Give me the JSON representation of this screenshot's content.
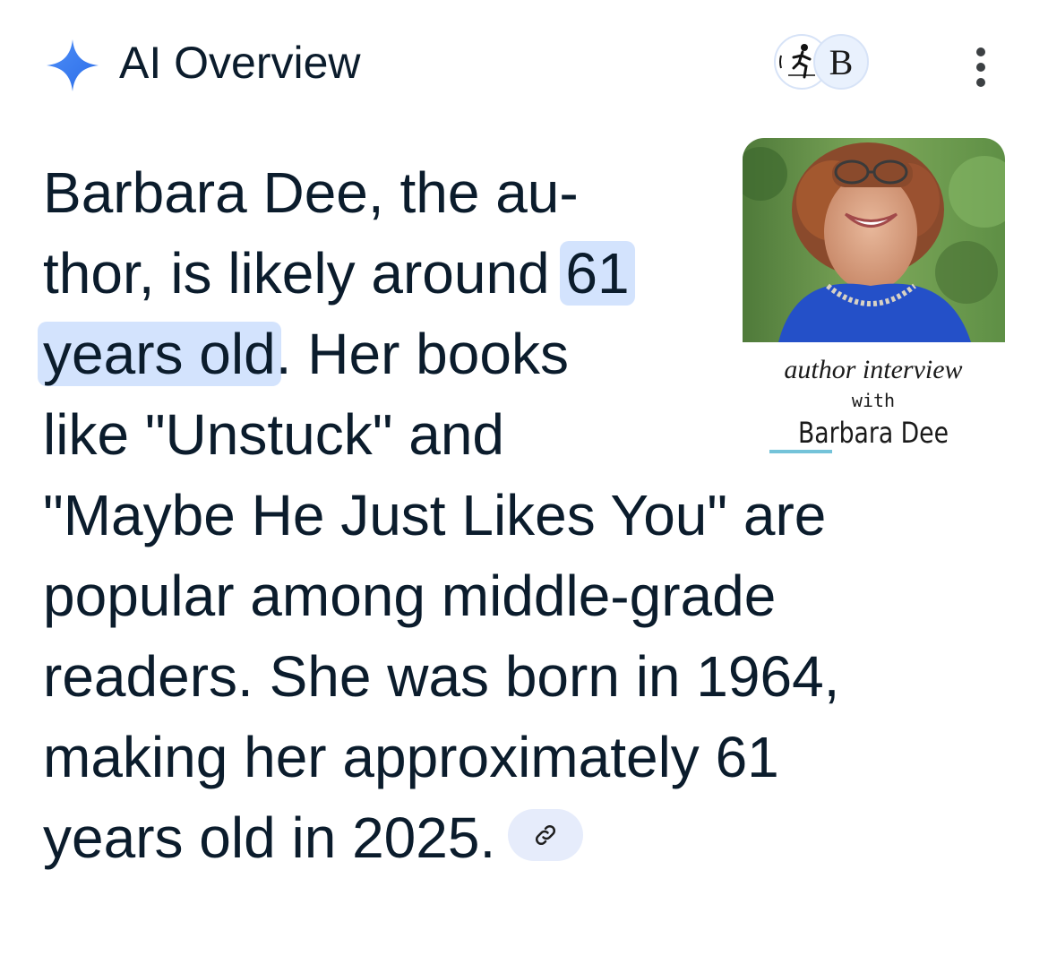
{
  "header": {
    "title": "AI Overview",
    "source_avatar_letter": "B",
    "sparkle_icon": "gemini-sparkle-icon",
    "more_icon": "more-vert-icon"
  },
  "thumbnail": {
    "caption_line1": "author interview",
    "caption_line2": "with",
    "caption_line3": "Barbara Dee"
  },
  "answer": {
    "lines": [
      {
        "before": "Barbara Dee, the au-",
        "highlight": "",
        "after": ""
      },
      {
        "before": "thor, is likely around ",
        "highlight": "61",
        "after": ""
      },
      {
        "before": "",
        "highlight": "years old",
        "after": ". Her books"
      },
      {
        "before": "like \"Unstuck\" and",
        "highlight": "",
        "after": ""
      },
      {
        "before": "\"Maybe He Just Likes You\" are",
        "highlight": "",
        "after": ""
      },
      {
        "before": "popular among middle-grade",
        "highlight": "",
        "after": ""
      },
      {
        "before": "readers. She was born in 1964,",
        "highlight": "",
        "after": ""
      },
      {
        "before": "making her approximately 61",
        "highlight": "",
        "after": ""
      },
      {
        "before": "years old in 2025.",
        "highlight": "",
        "after": ""
      }
    ],
    "link_icon": "link-icon"
  },
  "colors": {
    "text": "#0b1c2c",
    "highlight": "#d3e3fd",
    "sparkle": "#3d7bf2",
    "chip": "#e6ecfb"
  }
}
